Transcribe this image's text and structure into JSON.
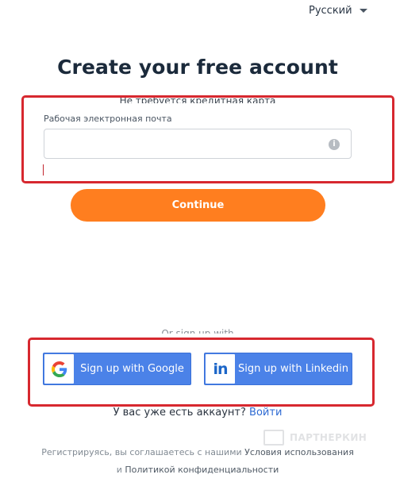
{
  "language": {
    "current": "Русский"
  },
  "title": "Create your free account",
  "subtitle": "Не требуется кредитная карта",
  "email": {
    "label": "Рабочая электронная почта",
    "value": "",
    "placeholder": ""
  },
  "continue_label": "Continue",
  "or_signup": "Or sign up with",
  "social": {
    "google_label": "Sign up with Google",
    "linkedin_label": "Sign up with Linkedin",
    "linkedin_icon_text": "in"
  },
  "account": {
    "question": "У вас уже есть аккаунт?",
    "login": "Войти"
  },
  "terms": {
    "prefix": "Регистрируясь, вы соглашаетесь с нашими",
    "tos": "Условия использования",
    "and": "и",
    "privacy": "Политикой конфиденциальности"
  },
  "watermark": "ПАРТНЕРКИН",
  "colors": {
    "accent": "#ff7e1f",
    "social_blue": "#4b82e8",
    "highlight": "#d7282f",
    "link": "#2f6bd3"
  }
}
